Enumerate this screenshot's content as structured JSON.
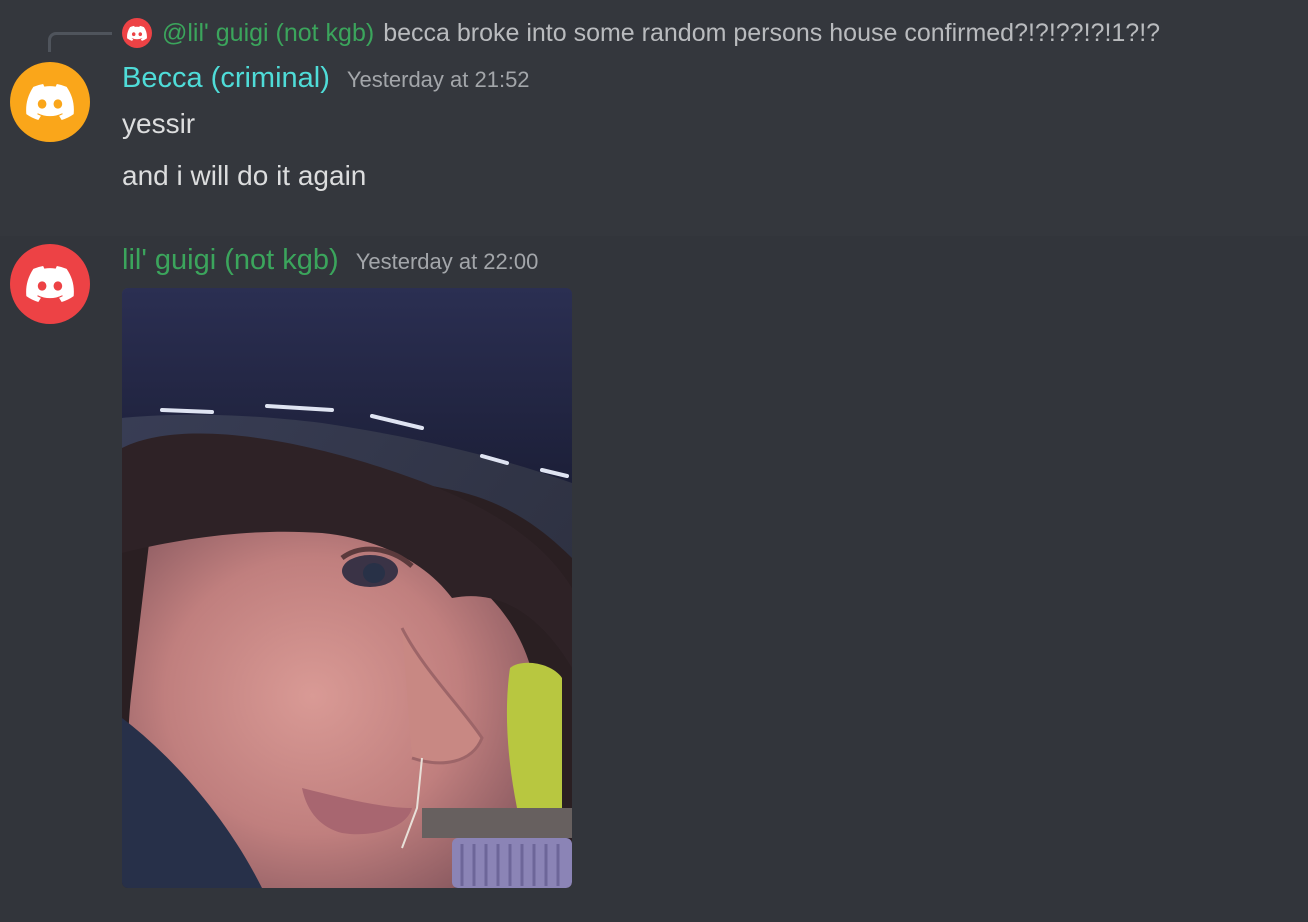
{
  "reply": {
    "author": "@lil' guigi (not kgb)",
    "text": "becca broke into some random persons house confirmed?!?!??!?!1?!?",
    "avatar_icon": "discord-logo-icon",
    "avatar_color": "#ed4245"
  },
  "messages": [
    {
      "username": "Becca (criminal)",
      "username_color": "#4fdcd8",
      "timestamp": "Yesterday at 21:52",
      "avatar_icon": "discord-logo-icon",
      "avatar_color": "#faa61a",
      "lines": [
        "yessir",
        "and i will do it again"
      ]
    },
    {
      "username": "lil' guigi (not kgb)",
      "username_color": "#3ba55c",
      "timestamp": "Yesterday at 22:00",
      "avatar_icon": "discord-logo-icon",
      "avatar_color": "#ed4245",
      "attachment": "photo"
    }
  ]
}
